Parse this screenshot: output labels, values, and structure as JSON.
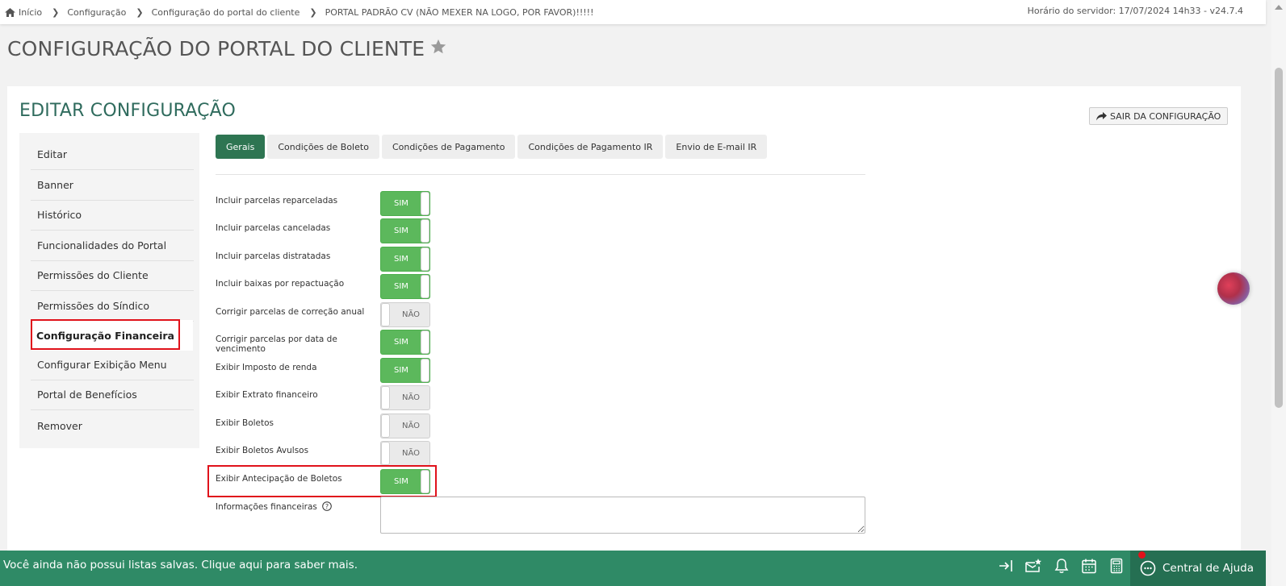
{
  "breadcrumb": {
    "items": [
      "Início",
      "Configuração",
      "Configuração do portal do cliente",
      "PORTAL PADRÃO CV (NÃO MEXER NA LOGO, POR FAVOR)!!!!!"
    ],
    "server_time": "Horário do servidor: 17/07/2024 14h33 - v24.7.4"
  },
  "page_title": "CONFIGURAÇÃO DO PORTAL DO CLIENTE",
  "panel": {
    "title": "EDITAR CONFIGURAÇÃO",
    "exit_button": "SAIR DA CONFIGURAÇÃO"
  },
  "sidebar": {
    "items": [
      {
        "label": "Editar"
      },
      {
        "label": "Banner"
      },
      {
        "label": "Histórico"
      },
      {
        "label": "Funcionalidades do Portal"
      },
      {
        "label": "Permissões do Cliente"
      },
      {
        "label": "Permissões do Síndico"
      },
      {
        "label": "Configuração Financeira",
        "active": true
      },
      {
        "label": "Configurar Exibição Menu"
      },
      {
        "label": "Portal de Benefícios"
      },
      {
        "label": "Remover"
      }
    ]
  },
  "tabs": [
    {
      "label": "Gerais",
      "active": true
    },
    {
      "label": "Condições de Boleto"
    },
    {
      "label": "Condições de Pagamento"
    },
    {
      "label": "Condições de Pagamento IR"
    },
    {
      "label": "Envio de E-mail IR"
    }
  ],
  "settings": [
    {
      "label": "Incluir parcelas reparceladas",
      "value": "SIM",
      "on": true
    },
    {
      "label": "Incluir parcelas canceladas",
      "value": "SIM",
      "on": true
    },
    {
      "label": "Incluir parcelas distratadas",
      "value": "SIM",
      "on": true
    },
    {
      "label": "Incluir baixas por repactuação",
      "value": "SIM",
      "on": true
    },
    {
      "label": "Corrigir parcelas de correção anual",
      "value": "NÃO",
      "on": false
    },
    {
      "label": "Corrigir parcelas por data de vencimento",
      "value": "SIM",
      "on": true
    },
    {
      "label": "Exibir Imposto de renda",
      "value": "SIM",
      "on": true
    },
    {
      "label": "Exibir Extrato financeiro",
      "value": "NÃO",
      "on": false
    },
    {
      "label": "Exibir Boletos",
      "value": "NÃO",
      "on": false
    },
    {
      "label": "Exibir Boletos Avulsos",
      "value": "NÃO",
      "on": false
    },
    {
      "label": "Exibir Antecipação de Boletos",
      "value": "SIM",
      "on": true
    }
  ],
  "financial_info": {
    "label": "Informações financeiras",
    "value": ""
  },
  "bottom_bar": {
    "message": "Você ainda não possui listas salvas. Clique aqui para saber mais.",
    "help_center": "Central de Ajuda"
  },
  "colors": {
    "accent_green": "#2e7552",
    "toggle_on": "#5cb85c",
    "bottom_bar": "#2f8a66",
    "highlight_red": "#e0121b",
    "title_teal": "#2f6b5d"
  },
  "icons": [
    "home-icon",
    "chevron-right-icon",
    "star-icon",
    "share-arrow-icon",
    "help-circle-icon",
    "sign-in-arrow-icon",
    "mail-star-icon",
    "bell-icon",
    "calendar-icon",
    "calculator-icon",
    "chat-bubble-icon"
  ]
}
